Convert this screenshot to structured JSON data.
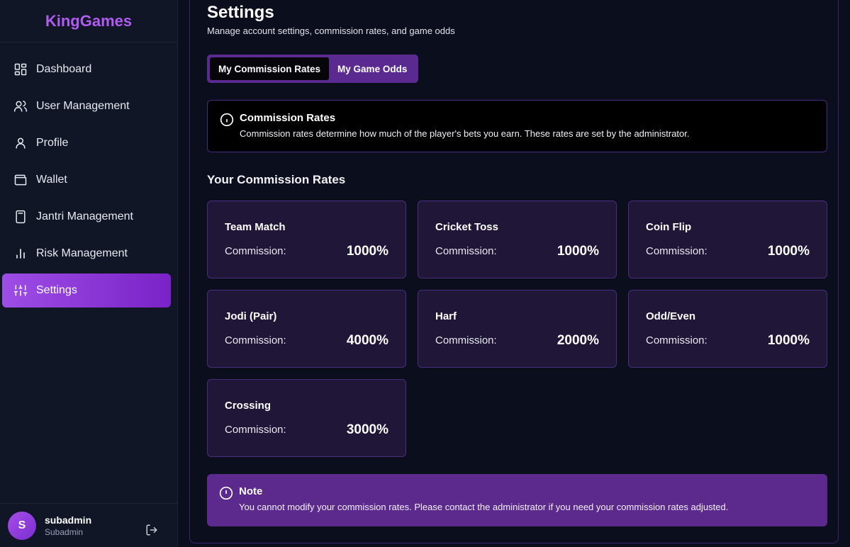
{
  "app": {
    "brand": "KingGames"
  },
  "sidebar": {
    "items": [
      {
        "label": "Dashboard",
        "icon": "dashboard-icon"
      },
      {
        "label": "User Management",
        "icon": "users-icon"
      },
      {
        "label": "Profile",
        "icon": "user-icon"
      },
      {
        "label": "Wallet",
        "icon": "wallet-icon"
      },
      {
        "label": "Jantri Management",
        "icon": "calculator-icon"
      },
      {
        "label": "Risk Management",
        "icon": "bar-chart-icon"
      },
      {
        "label": "Settings",
        "icon": "sliders-icon",
        "active": true
      }
    ],
    "user": {
      "initial": "S",
      "name": "subadmin",
      "role": "Subadmin"
    }
  },
  "page": {
    "title": "Settings",
    "subtitle": "Manage account settings, commission rates, and game odds",
    "tabs": [
      {
        "label": "My Commission Rates",
        "active": true
      },
      {
        "label": "My Game Odds",
        "active": false
      }
    ],
    "info": {
      "title": "Commission Rates",
      "text": "Commission rates determine how much of the player's bets you earn. These rates are set by the administrator."
    },
    "section_title": "Your Commission Rates",
    "commission_label": "Commission:",
    "rates": [
      {
        "name": "Team Match",
        "value": "1000%"
      },
      {
        "name": "Cricket Toss",
        "value": "1000%"
      },
      {
        "name": "Coin Flip",
        "value": "1000%"
      },
      {
        "name": "Jodi (Pair)",
        "value": "4000%"
      },
      {
        "name": "Harf",
        "value": "2000%"
      },
      {
        "name": "Odd/Even",
        "value": "1000%"
      },
      {
        "name": "Crossing",
        "value": "3000%"
      }
    ],
    "note": {
      "title": "Note",
      "text": "You cannot modify your commission rates. Please contact the administrator if you need your commission rates adjusted."
    }
  },
  "colors": {
    "accent": "#9d4ee6",
    "brand": "#b15cf0",
    "card_bg": "#1f1638",
    "note_bg": "#5c2a8c"
  }
}
